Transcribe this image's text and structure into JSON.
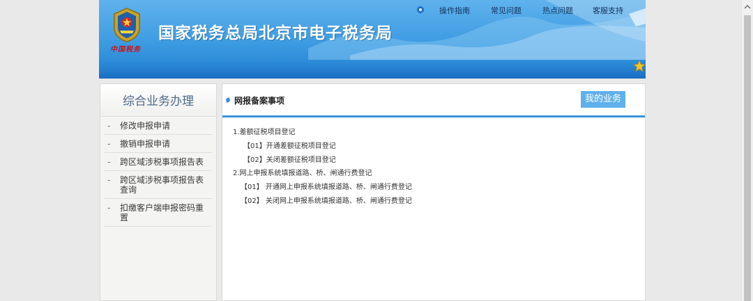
{
  "header": {
    "site_title": "国家税务总局北京市电子税务局",
    "brand_script": "中国税务",
    "nav": [
      "操作指南",
      "常见问题",
      "热点问题",
      "客服支持"
    ]
  },
  "sidebar": {
    "title": "综合业务办理",
    "items": [
      "修改申报申请",
      "撤销申报申请",
      "跨区域涉税事项报告表",
      "跨区域涉税事项报告表查询",
      "扣缴客户端申报密码重置"
    ]
  },
  "main": {
    "title": "网报备案事项",
    "my_business": "我的业务",
    "items": [
      "1.差额征税项目登记",
      "【01】开通差额征税项目登记",
      "【02】关闭差额征税项目登记",
      "2.网上申报系统填报道路、桥、闸通行费登记",
      "【01】 开通网上申报系统填报道路、桥、闸通行费登记",
      "【02】 关闭网上申报系统填报道路、桥、闸通行费登记"
    ]
  },
  "colors": {
    "header_blue": "#3d9be2",
    "accent_blue": "#3a92d8",
    "button_blue": "#5fb0ec",
    "seal_red": "#c4161c"
  },
  "icons": [
    "emblem-icon",
    "nav-dot-icon",
    "favorite-star-icon",
    "bullet-icon",
    "scroll-up-arrow-icon"
  ]
}
